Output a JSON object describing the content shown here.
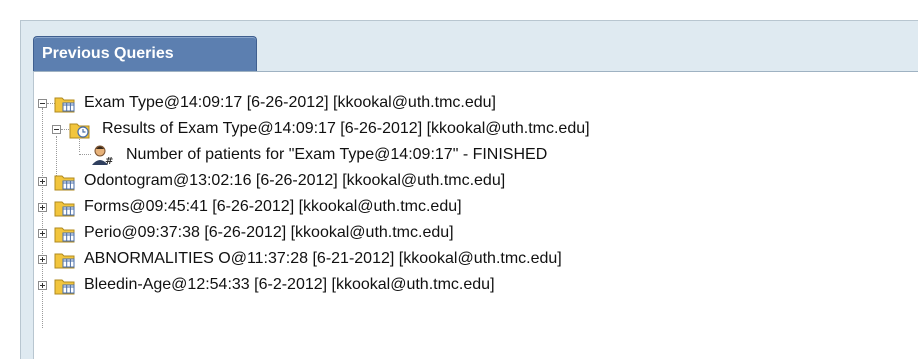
{
  "panel": {
    "tab_label": "Previous Queries"
  },
  "tree": {
    "root_items": [
      {
        "label": "Exam Type@14:09:17 [6-26-2012] [kkookal@uth.tmc.edu]",
        "expanded": true
      },
      {
        "label": "Odontogram@13:02:16 [6-26-2012] [kkookal@uth.tmc.edu]",
        "expanded": false
      },
      {
        "label": "Forms@09:45:41 [6-26-2012] [kkookal@uth.tmc.edu]",
        "expanded": false
      },
      {
        "label": "Perio@09:37:38 [6-26-2012] [kkookal@uth.tmc.edu]",
        "expanded": false
      },
      {
        "label": "ABNORMALITIES O@11:37:28 [6-21-2012] [kkookal@uth.tmc.edu]",
        "expanded": false
      },
      {
        "label": "Bleedin-Age@12:54:33 [6-2-2012] [kkookal@uth.tmc.edu]",
        "expanded": false
      }
    ],
    "child_result": {
      "label": "Results of Exam Type@14:09:17 [6-26-2012] [kkookal@uth.tmc.edu]",
      "expanded": true
    },
    "grandchild": {
      "label": "Number of patients for \"Exam Type@14:09:17\" - FINISHED"
    }
  },
  "icons": {
    "query_folder": "query-folder-icon",
    "results_folder": "results-folder-icon",
    "patient_count": "patient-count-icon"
  },
  "colors": {
    "tab_bg": "#5c7fb0",
    "panel_bg": "#dfeaf1",
    "folder": "#f0c040"
  }
}
